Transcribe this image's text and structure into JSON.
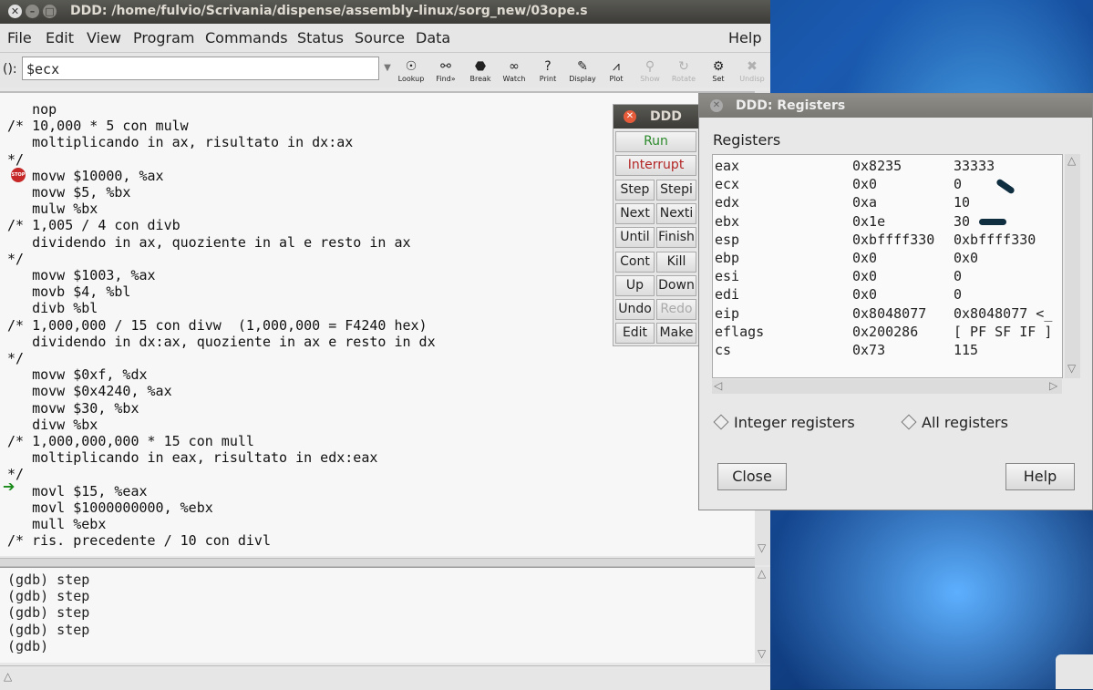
{
  "window": {
    "title": "DDD: /home/fulvio/Scrivania/dispense/assembly-linux/sorg_new/03ope.s"
  },
  "menubar": {
    "items": [
      "File",
      "Edit",
      "View",
      "Program",
      "Commands",
      "Status",
      "Source",
      "Data",
      "Help"
    ]
  },
  "argument": {
    "label": "():",
    "value": "$ecx"
  },
  "toolbar": {
    "items": [
      "Lookup",
      "Find»",
      "Break",
      "Watch",
      "Print",
      "Display",
      "Plot",
      "Show",
      "Rotate",
      "Set",
      "Undisp"
    ],
    "disabled": [
      "Show",
      "Rotate",
      "Undisp"
    ]
  },
  "source": {
    "lines": [
      "   nop",
      "/* 10,000 * 5 con mulw",
      "   moltiplicando in ax, risultato in dx:ax",
      "*/",
      "   movw $10000, %ax",
      "   movw $5, %bx",
      "   mulw %bx",
      "/* 1,005 / 4 con divb",
      "   dividendo in ax, quoziente in al e resto in ax",
      "*/",
      "   movw $1003, %ax",
      "   movb $4, %bl",
      "   divb %bl",
      "/* 1,000,000 / 15 con divw  (1,000,000 = F4240 hex)",
      "   dividendo in dx:ax, quoziente in ax e resto in dx",
      "*/",
      "   movw $0xf, %dx",
      "   movw $0x4240, %ax",
      "   movw $30, %bx",
      "   divw %bx",
      "/* 1,000,000,000 * 15 con mull",
      "   moltiplicando in eax, risultato in edx:eax",
      "*/",
      "   movl $15, %eax",
      "   movl $1000000000, %ebx",
      "   mull %ebx",
      "/* ris. precedente / 10 con divl"
    ],
    "breakpoint_label": "STOP"
  },
  "console": {
    "lines": [
      "(gdb) step",
      "(gdb) step",
      "(gdb) step",
      "(gdb) step",
      "(gdb)"
    ]
  },
  "command_tool": {
    "title": "DDD",
    "run": "Run",
    "interrupt": "Interrupt",
    "buttons": [
      [
        "Step",
        "Stepi"
      ],
      [
        "Next",
        "Nexti"
      ],
      [
        "Until",
        "Finish"
      ],
      [
        "Cont",
        "Kill"
      ],
      [
        "Up",
        "Down"
      ],
      [
        "Undo",
        "Redo"
      ],
      [
        "Edit",
        "Make"
      ]
    ]
  },
  "registers_window": {
    "title": "DDD: Registers",
    "section_label": "Registers",
    "rows": [
      {
        "name": "eax",
        "hex": "0x8235",
        "value": "33333"
      },
      {
        "name": "ecx",
        "hex": "0x0",
        "value": "0"
      },
      {
        "name": "edx",
        "hex": "0xa",
        "value": "10"
      },
      {
        "name": "ebx",
        "hex": "0x1e",
        "value": "30"
      },
      {
        "name": "esp",
        "hex": "0xbffff330",
        "value": "0xbffff330"
      },
      {
        "name": "ebp",
        "hex": "0x0",
        "value": "0x0"
      },
      {
        "name": "esi",
        "hex": "0x0",
        "value": "0"
      },
      {
        "name": "edi",
        "hex": "0x0",
        "value": "0"
      },
      {
        "name": "eip",
        "hex": "0x8048077",
        "value": "0x8048077 <_"
      },
      {
        "name": "eflags",
        "hex": "0x200286",
        "value": "[ PF SF IF ]"
      },
      {
        "name": "cs",
        "hex": "0x73",
        "value": "115"
      }
    ],
    "radio_integer": "Integer registers",
    "radio_all": "All registers",
    "close": "Close",
    "help": "Help"
  }
}
